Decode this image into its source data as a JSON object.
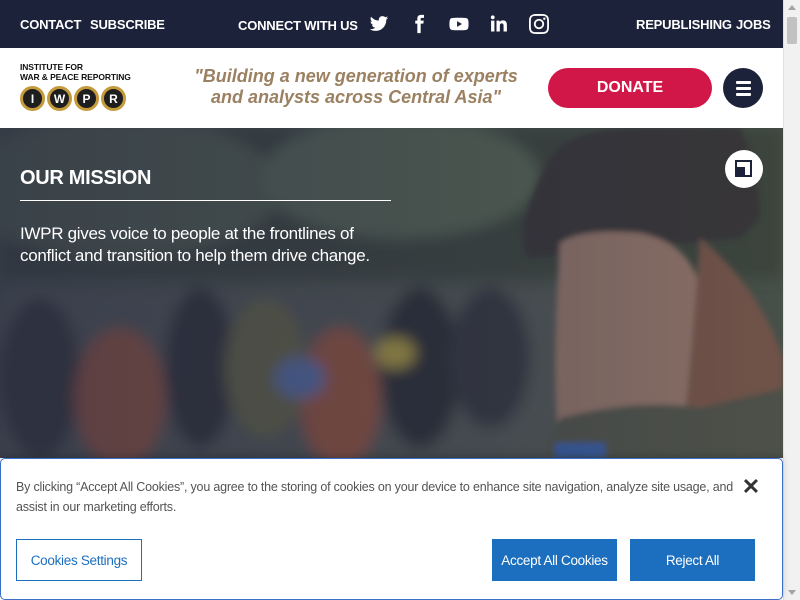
{
  "topbar": {
    "contact": "CONTACT",
    "subscribe": "SUBSCRIBE",
    "connect": "CONNECT WITH US",
    "republishing": "REPUBLISHING",
    "jobs": "JOBS",
    "social_icons": [
      "twitter-icon",
      "facebook-icon",
      "youtube-icon",
      "linkedin-icon",
      "instagram-icon"
    ]
  },
  "header": {
    "logo_line1": "INSTITUTE FOR",
    "logo_line2": "WAR & PEACE REPORTING",
    "logo_letters": [
      "I",
      "W",
      "P",
      "R"
    ],
    "tagline": "\"Building a new generation of experts and analysts across Central Asia\"",
    "donate": "DONATE",
    "colors": {
      "navy": "#1c2239",
      "donate": "#d11747",
      "tagline": "#9b8161",
      "logo_ring": "#c49a3b"
    }
  },
  "hero": {
    "title": "OUR MISSION",
    "text": "IWPR gives voice to people at the frontlines of conflict and transition to help them drive change."
  },
  "cookie_banner": {
    "text": "By clicking “Accept All Cookies”, you agree to the storing of cookies on your device to enhance site navigation, analyze site usage, and assist in our marketing efforts.",
    "settings": "Cookies Settings",
    "accept": "Accept All Cookies",
    "reject": "Reject All",
    "close": "✕",
    "colors": {
      "button": "#1c6fbf"
    }
  }
}
